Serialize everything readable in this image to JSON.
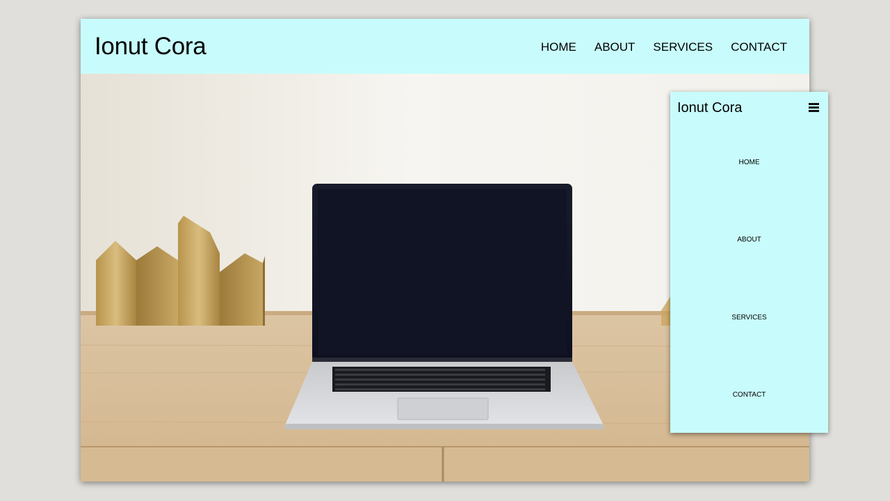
{
  "desktop": {
    "logo": "Ionut Cora",
    "nav": [
      "HOME",
      "ABOUT",
      "SERVICES",
      "CONTACT"
    ],
    "hero_image": "laptop-on-wooden-desk-photo"
  },
  "mobile": {
    "logo": "Ionut Cora",
    "menu_icon": "hamburger-menu-icon",
    "nav": [
      "HOME",
      "ABOUT",
      "SERVICES",
      "CONTACT"
    ]
  },
  "colors": {
    "header_bg": "#c8fcfc",
    "page_bg": "#e0dfdb"
  }
}
